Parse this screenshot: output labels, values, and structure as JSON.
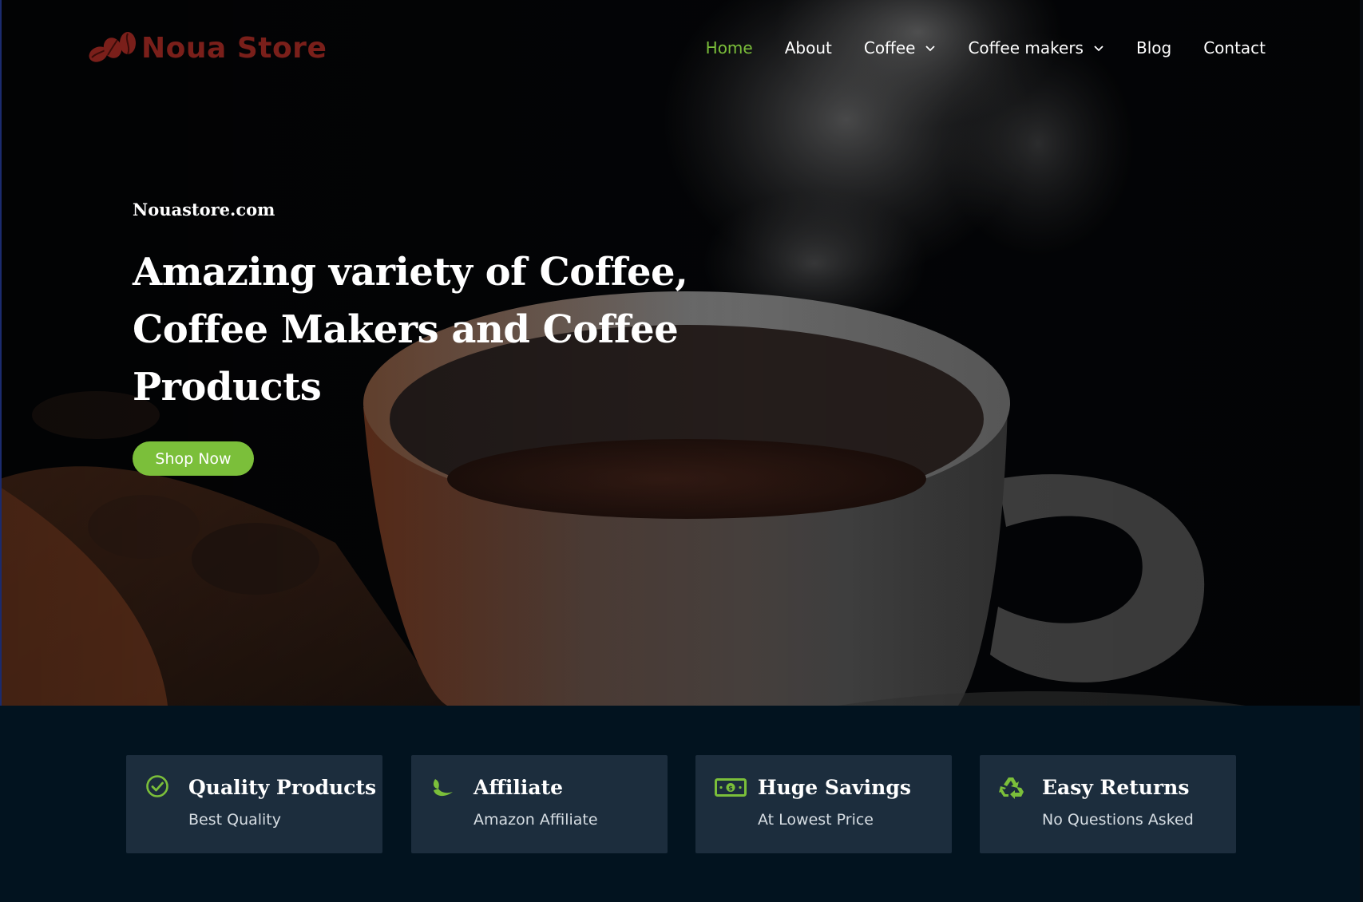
{
  "brand": {
    "name": "Noua Store",
    "logo_color": "#7a1f1a",
    "logo_icon": "coffee-beans-icon"
  },
  "nav": {
    "items": [
      {
        "label": "Home",
        "active": true,
        "has_dropdown": false
      },
      {
        "label": "About",
        "active": false,
        "has_dropdown": false
      },
      {
        "label": "Coffee",
        "active": false,
        "has_dropdown": true
      },
      {
        "label": "Coffee makers",
        "active": false,
        "has_dropdown": true
      },
      {
        "label": "Blog",
        "active": false,
        "has_dropdown": false
      },
      {
        "label": "Contact",
        "active": false,
        "has_dropdown": false
      }
    ],
    "active_color": "#7bbf3a"
  },
  "hero": {
    "site_url": "Nouastore.com",
    "headline_lines": [
      "Amazing variety of Coffee,",
      "Coffee Makers and Coffee",
      "Products"
    ],
    "cta_label": "Shop Now",
    "cta_color": "#7bbf3a"
  },
  "features": [
    {
      "title": "Quality Products",
      "subtitle": "Best Quality",
      "icon": "check-circle-icon"
    },
    {
      "title": "Affiliate",
      "subtitle": "Amazon Affiliate",
      "icon": "leaf-icon"
    },
    {
      "title": "Huge Savings",
      "subtitle": "At Lowest Price",
      "icon": "money-bill-icon"
    },
    {
      "title": "Easy Returns",
      "subtitle": "No Questions Asked",
      "icon": "recycle-icon"
    }
  ],
  "colors": {
    "accent": "#7bbf3a",
    "features_bg": "#02131f",
    "card_bg": "#1c2d3d"
  }
}
